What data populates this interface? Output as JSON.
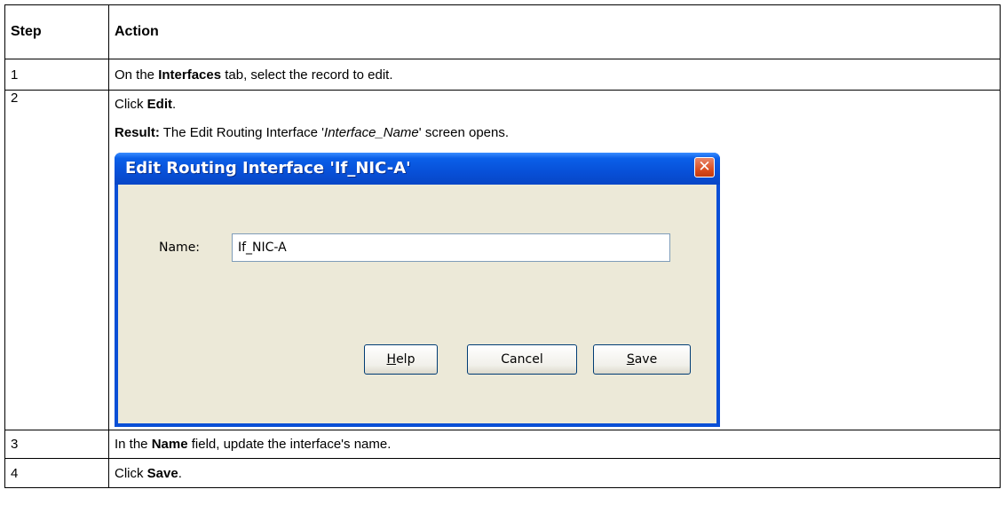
{
  "table": {
    "headers": {
      "step": "Step",
      "action": "Action"
    },
    "rows": [
      {
        "step": "1",
        "pre": "On the ",
        "bold": "Interfaces",
        "post": " tab, select the record to edit."
      },
      {
        "step": "2",
        "line1_pre": "Click ",
        "line1_bold": "Edit",
        "line1_post": ".",
        "result_label": "Result:",
        "result_pre": " The Edit Routing Interface '",
        "result_italic": "Interface_Name",
        "result_post": "' screen opens."
      },
      {
        "step": "3",
        "pre": "In the ",
        "bold": "Name",
        "post": " field, update the interface's name."
      },
      {
        "step": "4",
        "pre": "Click ",
        "bold": "Save",
        "post": "."
      }
    ]
  },
  "dialog": {
    "title": "Edit Routing Interface 'If_NIC-A'",
    "close_glyph": "✕",
    "name_label": "Name:",
    "name_value": "If_NIC-A",
    "help_first": "H",
    "help_rest": "elp",
    "cancel_label": "Cancel",
    "save_first": "S",
    "save_rest": "ave"
  }
}
